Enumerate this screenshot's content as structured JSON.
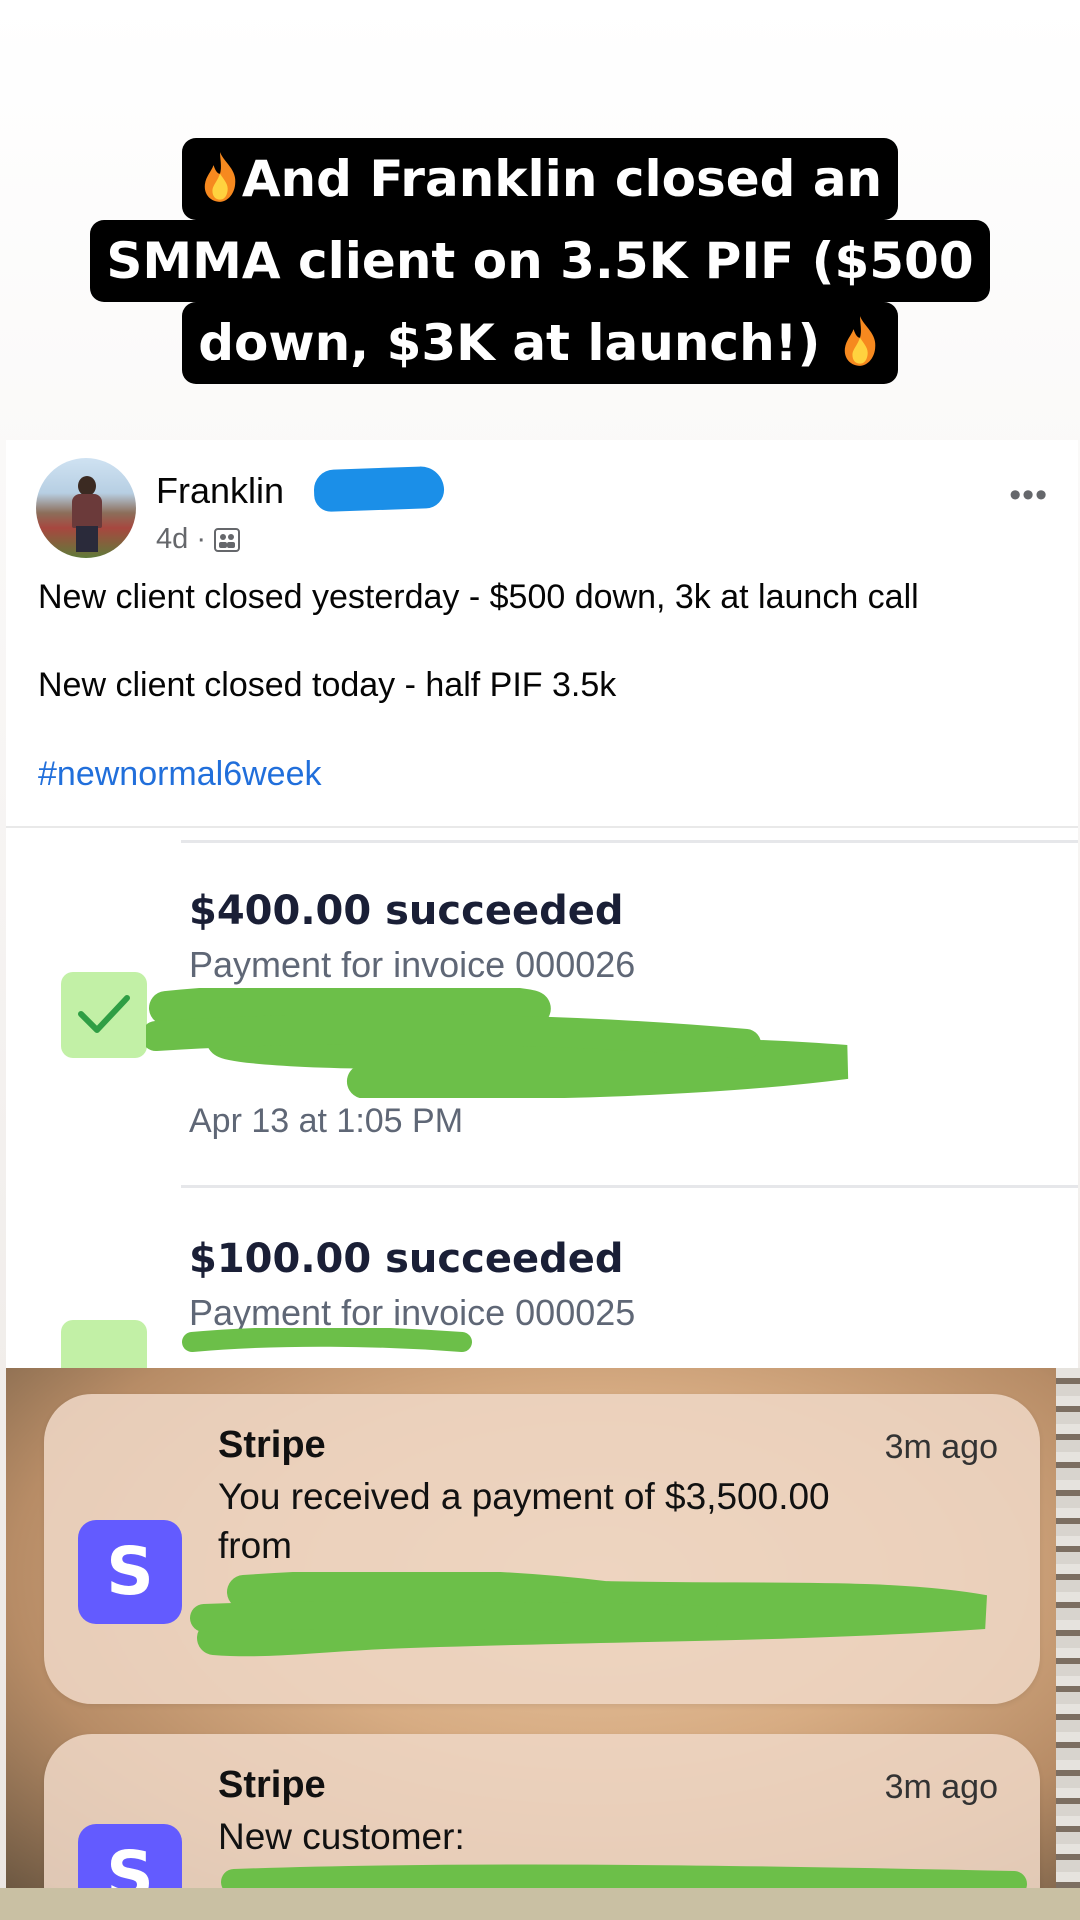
{
  "headline": {
    "line1": "And Franklin closed an",
    "line2": "SMMA client on 3.5K PIF ($500",
    "line3": "down, $3K at launch!)"
  },
  "post": {
    "author": "Franklin",
    "time": "4d",
    "separator": "·",
    "audience_icon": "group-audience-icon",
    "more_label": "•••",
    "text_line1": "New client closed yesterday - $500 down, 3k at launch call",
    "text_line2": "New client closed today - half PIF 3.5k",
    "hashtag": "#newnormal6week"
  },
  "stripe_transactions": [
    {
      "amount": "$400.00 succeeded",
      "description": "Payment for invoice 000026",
      "date": "Apr 13 at 1:05 PM",
      "status_icon": "check-icon"
    },
    {
      "amount": "$100.00 succeeded",
      "description": "Payment for invoice 000025",
      "status_icon": "check-icon"
    }
  ],
  "notifications": [
    {
      "app": "Stripe",
      "time": "3m ago",
      "body_line1": "You received a payment of $3,500.00",
      "body_line2": "from",
      "icon_letter": "S"
    },
    {
      "app": "Stripe",
      "time": "3m ago",
      "body_line1": "New customer:",
      "icon_letter": "S"
    }
  ],
  "colors": {
    "stripe_brand": "#635bff",
    "check_bg": "#c2f0a6",
    "check_mark": "#2f9e44",
    "hashtag": "#216fdb",
    "redaction_green": "#6cbf49",
    "redaction_blue": "#1b8fe8"
  }
}
